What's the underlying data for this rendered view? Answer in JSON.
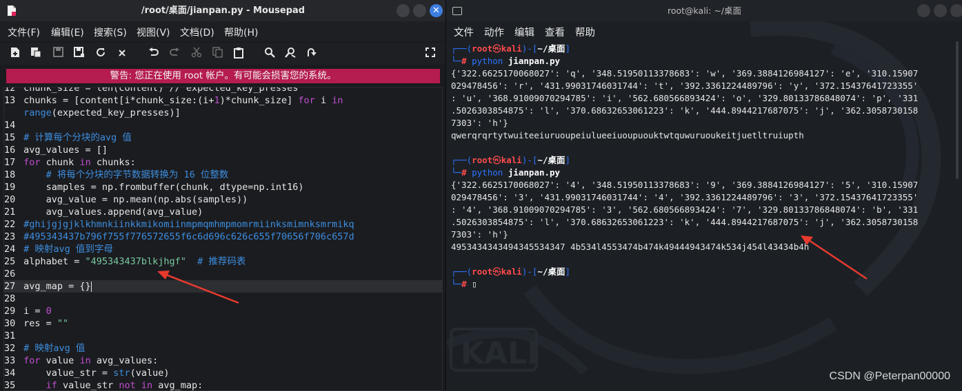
{
  "mousepad": {
    "title": "/root/桌面/jianpan.py - Mousepad",
    "close_glyph": "✕",
    "menu": [
      "文件(F)",
      "编辑(E)",
      "搜索(S)",
      "视图(V)",
      "文档(D)",
      "帮助(H)"
    ],
    "toolbar_icons": [
      "new-document-icon",
      "new-window-icon",
      "save-icon",
      "save-as-icon",
      "reload-icon",
      "close-tab-icon",
      "undo-icon",
      "redo-icon",
      "cut-icon",
      "copy-icon",
      "paste-icon",
      "search-icon",
      "replace-icon",
      "goto-icon",
      "fullscreen-icon"
    ],
    "warning": "警告: 您正在使用 root 帐户。有可能会损害您的系统。",
    "code": {
      "l12": {
        "n": "12",
        "text": "chunk_size = len(content) // expected_key_presses"
      },
      "l13a": {
        "n": "13",
        "p1": "chunks = [content[i*chunk_size:(i+",
        "one": "1",
        "p2": ")*chunk_size] ",
        "for": "for",
        "p3": " i ",
        "in": "in"
      },
      "l13b": {
        "fn": "range",
        "p": "(expected_key_presses)]"
      },
      "l14": {
        "n": "14"
      },
      "l15": {
        "n": "15",
        "cm": "# 计算每个分块的avg 值"
      },
      "l16": {
        "n": "16",
        "t": "avg_values = []"
      },
      "l17": {
        "n": "17",
        "for": "for",
        "p1": " chunk ",
        "in": "in",
        "p2": " chunks:"
      },
      "l18": {
        "n": "18",
        "cm": "    # 将每个分块的字节数据转换为 16 位整数"
      },
      "l19": {
        "n": "19",
        "t": "    samples = np.frombuffer(chunk, dtype=np.int16)"
      },
      "l20": {
        "n": "20",
        "t": "    avg_value = np.mean(np.abs(samples))"
      },
      "l21": {
        "n": "21",
        "t": "    avg_values.append(avg_value)"
      },
      "l22": {
        "n": "22",
        "cm": "#ghijgjgjklkhmnkiinkkmikomiinmpmqmhmpmomrmiinksmimnksmrmikq"
      },
      "l23": {
        "n": "23",
        "cm": "#495343437b796f755f776572655f6c6d696c626c655f70656f706c657d"
      },
      "l24": {
        "n": "24",
        "cm": "# 映射avg 值到字母"
      },
      "l25": {
        "n": "25",
        "p1": "alphabet = ",
        "st": "\"495343437blkjhgf\"",
        "cm": "  # 推荐码表"
      },
      "l26": {
        "n": "26"
      },
      "l27": {
        "n": "27",
        "t": "avg_map = {}"
      },
      "l28": {
        "n": "28"
      },
      "l29": {
        "n": "29",
        "p1": "i = ",
        "num": "0"
      },
      "l30": {
        "n": "30",
        "p1": "res = ",
        "st": "\"\""
      },
      "l31": {
        "n": "31"
      },
      "l32": {
        "n": "32",
        "cm": "# 映射avg 值"
      },
      "l33": {
        "n": "33",
        "for": "for",
        "p1": " value ",
        "in": "in",
        "p2": " avg_values:"
      },
      "l34": {
        "n": "34",
        "p1": "    value_str = ",
        "fn": "str",
        "p2": "(value)"
      },
      "l35": {
        "n": "35",
        "p1": "    ",
        "if": "if",
        "p2": " value_str ",
        "notin": "not in",
        "p3": " avg_map:"
      }
    }
  },
  "terminal": {
    "title": "root@kali: ~/桌面",
    "menu": [
      "文件",
      "动作",
      "编辑",
      "查看",
      "帮助"
    ],
    "prompt": {
      "top_left": "┌──(",
      "user": "root",
      "skull": "㉿",
      "host": "kali",
      "mid": ")-[",
      "path": "~/桌面",
      "end": "]",
      "bottom_left": "└─",
      "hash": "#"
    },
    "runs": [
      {
        "cmd_a": "python",
        "cmd_b": "jianpan.py",
        "out": [
          "{'322.6625170068027': 'q', '348.51950113378683': 'w', '369.3884126984127': 'e', '310.15907",
          "029478456': 'r', '431.99031746031744': 't', '392.3361224489796': 'y', '372.15437641723355'",
          ": 'u', '368.91009070294785': 'i', '562.680566893424': 'o', '329.80133786848074': 'p', '331",
          ".5026303854875': 'l', '370.68632653061223': 'k', '444.8944217687075': 'j', '362.3058730158",
          "7303': 'h'}",
          "qwerqrqrtytwuiteeiuruoupeiulueeiuoupuouktwtquwuruoukeitjuetltruiupth"
        ]
      },
      {
        "cmd_a": "python",
        "cmd_b": "jianpan.py",
        "out": [
          "{'322.6625170068027': '4', '348.51950113378683': '9', '369.3884126984127': '5', '310.15907",
          "029478456': '3', '431.99031746031744': '4', '392.3361224489796': '3', '372.15437641723355'",
          ": '4', '368.91009070294785': '3', '562.680566893424': '7', '329.80133786848074': 'b', '331",
          ".5026303854875': 'l', '370.68632653061223': 'k', '444.8944217687075': 'j', '362.3058730158",
          "7303': 'h'}",
          "4953434343494345534347 4b534l4553474b474k49444943474k534j454l43434b4h"
        ]
      }
    ],
    "cursor": "▯",
    "watermark": "CSDN @Peterpan00000"
  }
}
